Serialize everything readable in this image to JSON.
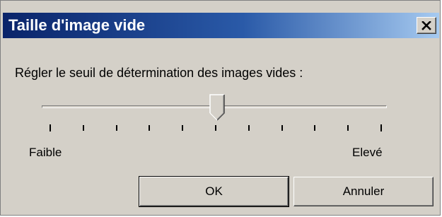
{
  "window": {
    "title": "Taille d'image vide",
    "close_icon": "close-icon"
  },
  "prompt": "Régler le seuil de détermination des images vides :",
  "slider": {
    "min_label": "Faible",
    "max_label": "Elevé",
    "tick_count": 11,
    "value_fraction": 0.5
  },
  "buttons": {
    "ok": "OK",
    "cancel": "Annuler"
  },
  "colors": {
    "dialog_bg": "#d4d0c8",
    "titlebar_start": "#0a246a",
    "titlebar_end": "#a6caf0"
  }
}
